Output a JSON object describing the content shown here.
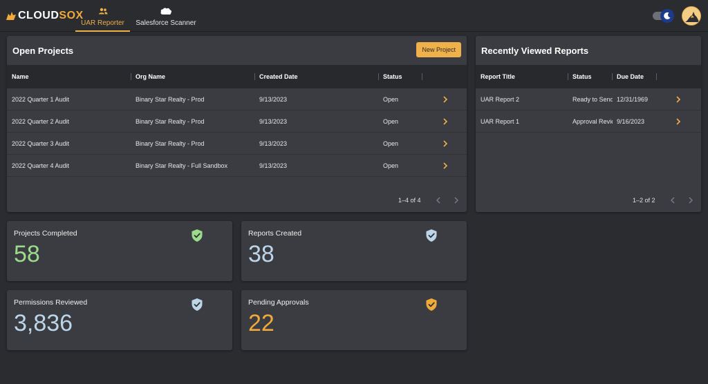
{
  "app": {
    "logo_cloud": "CLOUD",
    "logo_sox": "SOX"
  },
  "nav": {
    "tabs": [
      {
        "label": "UAR Reporter",
        "icon": "users-icon",
        "active": true
      },
      {
        "label": "Salesforce Scanner",
        "icon": "salesforce-cloud-icon",
        "active": false
      }
    ]
  },
  "colors": {
    "accent": "#f0b04a",
    "green": "#9bdb8b",
    "blue": "#bcd5e8",
    "orange": "#f0a93b"
  },
  "open_projects": {
    "title": "Open Projects",
    "new_button": "New Project",
    "columns": [
      "Name",
      "Org Name",
      "Created Date",
      "Status"
    ],
    "rows": [
      [
        "2022 Quarter 1 Audit",
        "Binary Star Realty - Prod",
        "9/13/2023",
        "Open"
      ],
      [
        "2022 Quarter 2 Audit",
        "Binary Star Realty - Prod",
        "9/13/2023",
        "Open"
      ],
      [
        "2022 Quarter 3 Audit",
        "Binary Star Realty - Prod",
        "9/13/2023",
        "Open"
      ],
      [
        "2022 Quarter 4 Audit",
        "Binary Star Realty - Full Sandbox",
        "9/13/2023",
        "Open"
      ]
    ],
    "pagination": "1–4 of 4"
  },
  "recent_reports": {
    "title": "Recently Viewed Reports",
    "columns": [
      "Report Title",
      "Status",
      "Due Date"
    ],
    "rows": [
      [
        "UAR Report 2",
        "Ready to Send",
        "12/31/1969"
      ],
      [
        "UAR Report 1",
        "Approval Review",
        "9/16/2023"
      ]
    ],
    "pagination": "1–2 of 2"
  },
  "stats": [
    {
      "label": "Projects Completed",
      "value": "58",
      "icon": "shield-check-icon",
      "color": "#9bdb8b"
    },
    {
      "label": "Reports Created",
      "value": "38",
      "icon": "shield-check-icon",
      "color": "#bcd5e8"
    },
    {
      "label": "Permissions Reviewed",
      "value": "3,836",
      "icon": "shield-check-icon",
      "color": "#bcd5e8"
    },
    {
      "label": "Pending Approvals",
      "value": "22",
      "icon": "shield-check-icon",
      "color": "#f0a93b"
    }
  ]
}
